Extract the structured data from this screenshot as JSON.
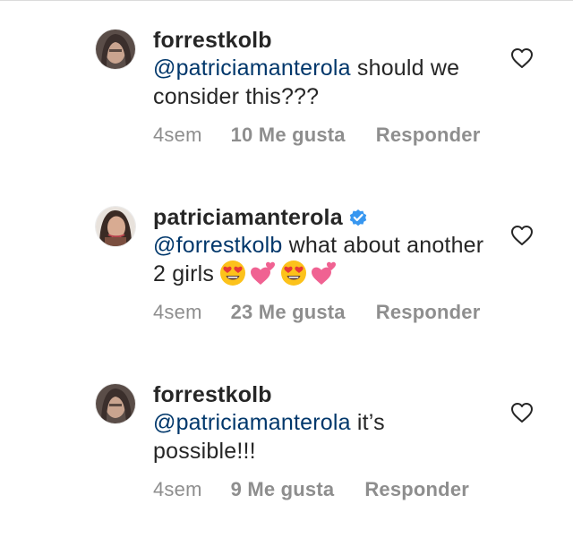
{
  "comments": [
    {
      "username": "forrestkolb",
      "verified": false,
      "mention": "@patriciamanterola",
      "text": " should we consider this???",
      "emojis": [],
      "time": "4sem",
      "likes": "10 Me gusta",
      "reply": "Responder"
    },
    {
      "username": "patriciamanterola",
      "verified": true,
      "mention": "@forrestkolb",
      "text": " what about another 2 girls",
      "emojis": [
        "heart-eyes-emoji",
        "two-hearts-emoji",
        "heart-eyes-emoji",
        "two-hearts-emoji"
      ],
      "time": "4sem",
      "likes": "23 Me gusta",
      "reply": "Responder"
    },
    {
      "username": "forrestkolb",
      "verified": false,
      "mention": "@patriciamanterola",
      "text": " it’s possible!!!",
      "emojis": [],
      "time": "4sem",
      "likes": "9 Me gusta",
      "reply": "Responder"
    }
  ],
  "icons": {
    "like": "heart-outline-icon",
    "verified": "verified-badge-icon"
  },
  "colors": {
    "text": "#262626",
    "mention": "#00376b",
    "meta": "#8e8e8e",
    "verified": "#3897f0"
  }
}
